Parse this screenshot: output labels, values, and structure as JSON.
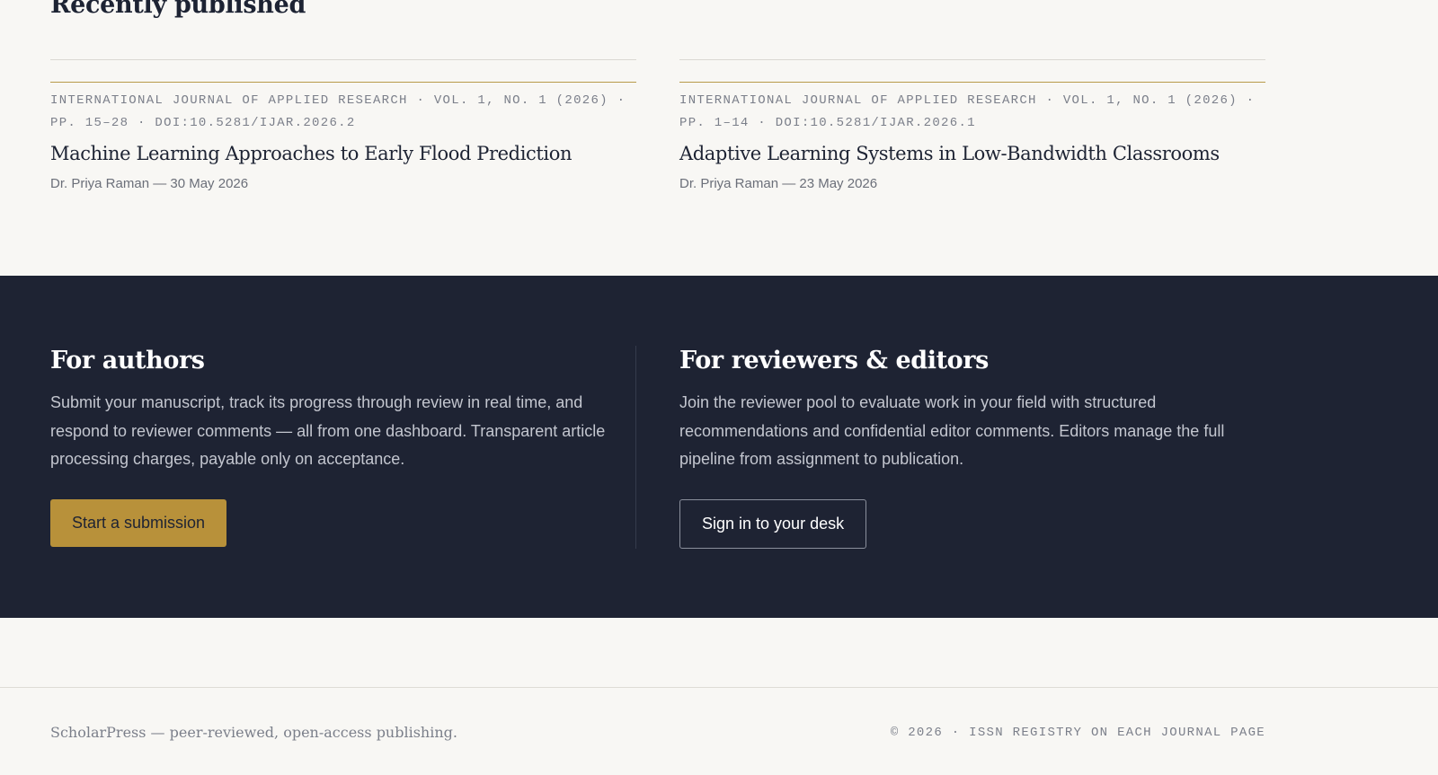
{
  "recent": {
    "title": "Recently published",
    "articles": [
      {
        "meta_line1": "International Journal of Applied Research  ·  Vol. 1, No. 1 (2026)  ·",
        "meta_line2": "pp. 15–28  ·  doi:10.5281/ijar.2026.2",
        "title": "Machine Learning Approaches to Early Flood Prediction",
        "byline": "Dr. Priya Raman — 30 May 2026"
      },
      {
        "meta_line1": "International Journal of Applied Research  ·  Vol. 1, No. 1 (2026)  ·",
        "meta_line2": "pp. 1–14  ·  doi:10.5281/ijar.2026.1",
        "title": "Adaptive Learning Systems in Low-Bandwidth Classrooms",
        "byline": "Dr. Priya Raman — 23 May 2026"
      }
    ]
  },
  "authors": {
    "heading": "For authors",
    "body": "Submit your manuscript, track its progress through review in real time, and respond to reviewer comments — all from one dashboard. Transparent article processing charges, payable only on acceptance.",
    "button": "Start a submission"
  },
  "reviewers": {
    "heading": "For reviewers & editors",
    "body": "Join the reviewer pool to evaluate work in your field with structured recommendations and confidential editor comments. Editors manage the full pipeline from assignment to publication.",
    "button": "Sign in to your desk"
  },
  "footer": {
    "left": "ScholarPress — peer-reviewed, open-access publishing.",
    "right": "© 2026 · ISSN registry on each journal page"
  },
  "colors": {
    "accent_gold": "#b8913a",
    "dark_band": "#1e2333",
    "page_bg": "#f8f7f4"
  }
}
